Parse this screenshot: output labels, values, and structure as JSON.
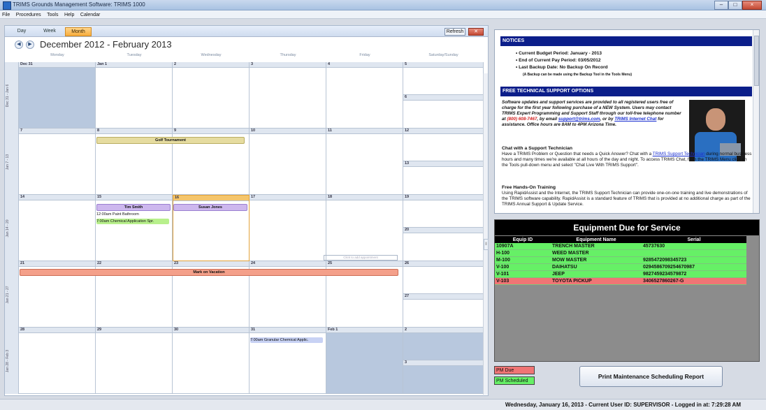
{
  "window": {
    "title": "TRIMS Grounds Management Software: TRIMS 1000",
    "controls": [
      "–",
      "□",
      "×"
    ]
  },
  "menu": [
    "File",
    "Procedures",
    "Tools",
    "Help",
    "Calendar"
  ],
  "calendar": {
    "tabs": [
      "Day",
      "Week",
      "Month"
    ],
    "active_tab": "Month",
    "refresh_label": "Refresh",
    "range_title": "December 2012 - February 2013",
    "days": [
      "Monday",
      "Tuesday",
      "Wednesday",
      "Thursday",
      "Friday",
      "Saturday/Sunday"
    ],
    "weeks": [
      {
        "label": "Dec 31 - Jan 6",
        "dates": [
          "Dec 31",
          "Jan 1",
          "2",
          "3",
          "4",
          "5",
          "6"
        ]
      },
      {
        "label": "Jan 7 - 13",
        "dates": [
          "7",
          "8",
          "9",
          "10",
          "11",
          "12",
          "13"
        ]
      },
      {
        "label": "Jan 14 - 20",
        "dates": [
          "14",
          "15",
          "16",
          "17",
          "18",
          "19",
          "20"
        ]
      },
      {
        "label": "Jan 21 - 27",
        "dates": [
          "21",
          "22",
          "23",
          "24",
          "25",
          "26",
          "27"
        ]
      },
      {
        "label": "Jan 28 - Feb 3",
        "dates": [
          "28",
          "29",
          "30",
          "31",
          "Feb 1",
          "2",
          "3"
        ]
      }
    ],
    "events": {
      "golf": "Golf Tournament",
      "tim": "Tim Smith",
      "paint": "12:00am  Paint Bathroom",
      "chem": "7:00am  Chemical Application Spr.",
      "susan": "Susan Jones",
      "vacation": "Mark on Vacation",
      "granular": "7:00am  Granular Chemical Applic.",
      "click_add": "Click to add appointment"
    },
    "colors": {
      "golf": "#e6dca0",
      "person": "#cdb7ee",
      "chem": "#b8f08c",
      "vacation": "#f4a08a",
      "granular": "#c8d2f4",
      "today": "#f5c56b"
    }
  },
  "notices": {
    "header": "NOTICES",
    "items": [
      "Current Budget Period:  January - 2013",
      "End of Current Pay Period: 03/05/2012",
      "Last Backup Date: No Backup On Record"
    ],
    "backup_note": "(A Backup can be made using the Backup Tool in the Tools Menu)",
    "support_header": "FREE TECHNICAL SUPPORT OPTIONS",
    "support_text_1": "Software updates and support services are provided to all registered users free of charge for the first year following purchase of a NEW System. Users may contact TRIMS Expert Programming and Support Staff through our toll-free telephone number at ",
    "support_phone": "(800) 608-7467",
    "support_text_2": ", by email ",
    "support_email": "support@trims.com",
    "support_text_3": ", or by ",
    "support_chat": "TRIMS Internet Chat",
    "support_text_4": " for assistance. Office hours are 8AM to 4PM Arizona Time.",
    "chat_title": "Chat with a Support Technician",
    "chat_text_1": "Have a TRIMS Problem or Question that needs a Quick Answer? Chat with a ",
    "chat_link": "TRIMS Support Technician",
    "chat_text_2": " during normal business hours and many times we're available at all hours of the day and night.  To access TRIMS Chat, from the TRIMS Menu click on the Tools pull-down menu and select \"Chat Live With TRIMS Support\".",
    "training_title": "Free Hands-On Training",
    "training_text": "Using RapidAssist and the Internet, the TRIMS Support Technician can provide one-on-one training and live demonstrations of the TRIMS software capability.  RapidAssist is a standard feature of TRIMS that is provided at no additional charge as part of the TRIMS Annual Support & Update Service."
  },
  "equipment": {
    "title": "Equipment Due for Service",
    "columns": [
      "Equip ID",
      "Equipment Name",
      "Serial"
    ],
    "rows": [
      {
        "id": "10907A",
        "name": "TRENCH MASTER",
        "serial": "45737630",
        "status": "scheduled"
      },
      {
        "id": "H-100",
        "name": "WEED MASTER",
        "serial": "",
        "status": "scheduled"
      },
      {
        "id": "M-100",
        "name": "MOW MASTER",
        "serial": "9285472098345723",
        "status": "scheduled"
      },
      {
        "id": "V-100",
        "name": "DAIHATSU",
        "serial": "0294586709254670987",
        "status": "scheduled"
      },
      {
        "id": "V-101",
        "name": "JEEP",
        "serial": "9827459234579872",
        "status": "scheduled"
      },
      {
        "id": "V-103",
        "name": "TOYOTA PICKUP",
        "serial": "3406527860267-G",
        "status": "due"
      }
    ],
    "legend_due": "PM Due",
    "legend_scheduled": "PM Scheduled",
    "print_button": "Print Maintenance Scheduling Report"
  },
  "status_bar": "Wednesday, January 16, 2013 - Current User ID: SUPERVISOR - Logged in at: 7:29:28 AM"
}
